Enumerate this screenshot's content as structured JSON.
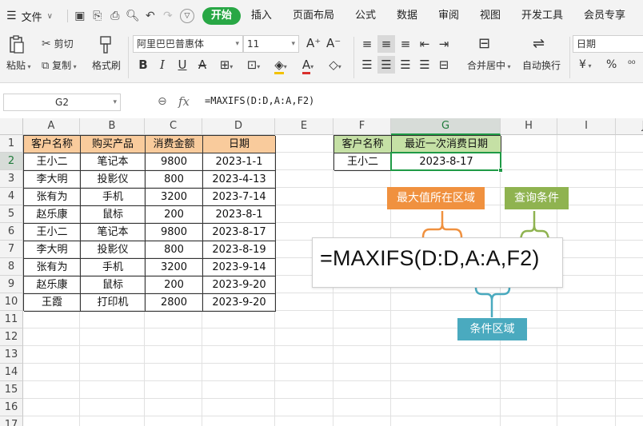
{
  "menubar": {
    "file_label": "文件",
    "tabs": [
      {
        "label": "开始",
        "active": true
      },
      {
        "label": "插入"
      },
      {
        "label": "页面布局"
      },
      {
        "label": "公式"
      },
      {
        "label": "数据"
      },
      {
        "label": "审阅"
      },
      {
        "label": "视图"
      },
      {
        "label": "开发工具"
      },
      {
        "label": "会员专享"
      }
    ]
  },
  "toolbar": {
    "cut": "剪切",
    "paste": "粘贴",
    "copy": "复制",
    "format_painter": "格式刷",
    "font_name": "阿里巴巴普惠体",
    "font_size": "11",
    "merge_center": "合并居中",
    "auto_wrap": "自动换行",
    "number_format": "日期",
    "currency_symbol": "¥",
    "percent_symbol": "%",
    "increase_font": "A⁺",
    "decrease_font": "A⁻"
  },
  "formula_bar": {
    "cell_ref": "G2",
    "fx": "fx",
    "formula": "=MAXIFS(D:D,A:A,F2)"
  },
  "columns": [
    "A",
    "B",
    "C",
    "D",
    "E",
    "F",
    "G",
    "H",
    "I",
    "J"
  ],
  "rows": [
    "1",
    "2",
    "3",
    "4",
    "5",
    "6",
    "7",
    "8",
    "9",
    "10",
    "11",
    "12",
    "13",
    "14",
    "15",
    "16",
    "17"
  ],
  "table": {
    "headers": [
      "客户名称",
      "购买产品",
      "消费金额",
      "日期"
    ],
    "rows": [
      [
        "王小二",
        "笔记本",
        "9800",
        "2023-1-1"
      ],
      [
        "李大明",
        "投影仪",
        "800",
        "2023-4-13"
      ],
      [
        "张有为",
        "手机",
        "3200",
        "2023-7-14"
      ],
      [
        "赵乐康",
        "鼠标",
        "200",
        "2023-8-1"
      ],
      [
        "王小二",
        "笔记本",
        "9800",
        "2023-8-17"
      ],
      [
        "李大明",
        "投影仪",
        "800",
        "2023-8-19"
      ],
      [
        "张有为",
        "手机",
        "3200",
        "2023-9-14"
      ],
      [
        "赵乐康",
        "鼠标",
        "200",
        "2023-9-20"
      ],
      [
        "王霞",
        "打印机",
        "2800",
        "2023-9-20"
      ]
    ]
  },
  "result_table": {
    "headers": [
      "客户名称",
      "最近一次消费日期"
    ],
    "row": [
      "王小二",
      "2023-8-17"
    ]
  },
  "annotation": {
    "formula": "=MAXIFS(D:D,A:A,F2)",
    "label_max_range": "最大值所在区域",
    "label_criteria": "查询条件",
    "label_criteria_range": "条件区域",
    "color_orange": "#f0913f",
    "color_green": "#8fb350",
    "color_teal": "#4aaabf"
  }
}
